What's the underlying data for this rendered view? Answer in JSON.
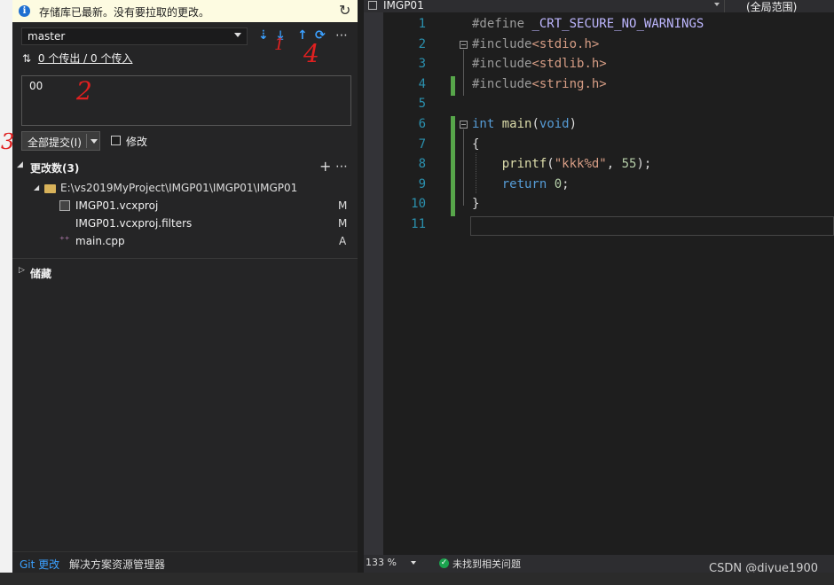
{
  "info_bar": {
    "message": "存储库已最新。没有要拉取的更改。"
  },
  "branch": {
    "name": "master"
  },
  "sync": {
    "label": "0 个传出 / 0 个传入"
  },
  "commit_message": {
    "value": "00"
  },
  "commit_button": {
    "label": "全部提交(I)"
  },
  "amend": {
    "label": "修改"
  },
  "changes": {
    "header": "更改数(3)",
    "folder": "E:\\vs2019MyProject\\IMGP01\\IMGP01\\IMGP01",
    "files": [
      {
        "name": "IMGP01.vcxproj",
        "status": "M"
      },
      {
        "name": "IMGP01.vcxproj.filters",
        "status": "M"
      },
      {
        "name": "main.cpp",
        "status": "A"
      }
    ]
  },
  "stash": {
    "header": "储藏"
  },
  "annotations": [
    "1",
    "2",
    "3",
    "4"
  ],
  "bottom_tabs": [
    "Git 更改",
    "解决方案资源管理器"
  ],
  "editor": {
    "tab": "IMGP01",
    "scope": "(全局范围)",
    "line_numbers": [
      "1",
      "2",
      "3",
      "4",
      "5",
      "6",
      "7",
      "8",
      "9",
      "10",
      "11"
    ],
    "lines": [
      "#define _CRT_SECURE_NO_WARNINGS",
      "#include<stdio.h>",
      "#include<stdlib.h>",
      "#include<string.h>",
      "",
      "int main(void)",
      "{",
      "    printf(\"kkk%d\", 55);",
      "    return 0;",
      "}",
      ""
    ]
  },
  "editor_status": {
    "zoom": "133 %",
    "message": "未找到相关问题"
  },
  "watermark": "CSDN @diyue1900",
  "colors": {
    "accent": "#3ba0ff",
    "annotation": "#e02020",
    "change_bar": "#57a64a"
  }
}
